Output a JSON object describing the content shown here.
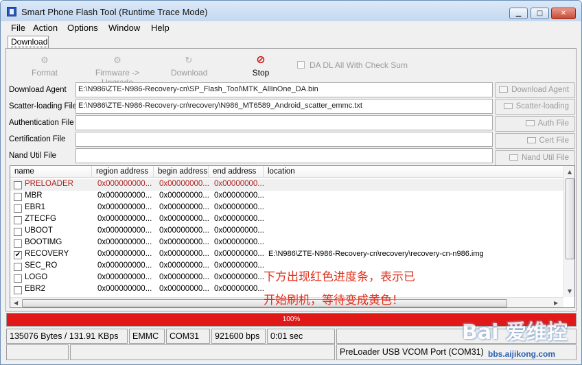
{
  "window": {
    "title": "Smart Phone Flash Tool (Runtime Trace Mode)"
  },
  "menu": [
    "File",
    "Action",
    "Options",
    "Window",
    "Help"
  ],
  "tab": "Download",
  "toolbar": {
    "format": "Format",
    "upgrade": "Firmware -> Upgrade",
    "download": "Download",
    "stop": "Stop",
    "checksum": "DA DL All With Check Sum"
  },
  "files": [
    {
      "label": "Download Agent",
      "value": "E:\\N986\\ZTE-N986-Recovery-cn\\SP_Flash_Tool\\MTK_AllInOne_DA.bin",
      "button": "Download Agent"
    },
    {
      "label": "Scatter-loading File",
      "value": "E:\\N986\\ZTE-N986-Recovery-cn\\recovery\\N986_MT6589_Android_scatter_emmc.txt",
      "button": "Scatter-loading"
    },
    {
      "label": "Authentication File",
      "value": "",
      "button": "Auth File"
    },
    {
      "label": "Certification File",
      "value": "",
      "button": "Cert File"
    },
    {
      "label": "Nand Util File",
      "value": "",
      "button": "Nand Util File"
    }
  ],
  "list": {
    "columns": [
      "name",
      "region address",
      "begin address",
      "end address",
      "location"
    ],
    "rows": [
      {
        "name": "PRELOADER",
        "region": "0x000000000...",
        "begin": "0x00000000...",
        "end": "0x00000000...",
        "location": "",
        "checked": false,
        "red": true
      },
      {
        "name": "MBR",
        "region": "0x000000000...",
        "begin": "0x00000000...",
        "end": "0x00000000...",
        "location": "",
        "checked": false,
        "red": false
      },
      {
        "name": "EBR1",
        "region": "0x000000000...",
        "begin": "0x00000000...",
        "end": "0x00000000...",
        "location": "",
        "checked": false,
        "red": false
      },
      {
        "name": "ZTECFG",
        "region": "0x000000000...",
        "begin": "0x00000000...",
        "end": "0x00000000...",
        "location": "",
        "checked": false,
        "red": false
      },
      {
        "name": "UBOOT",
        "region": "0x000000000...",
        "begin": "0x00000000...",
        "end": "0x00000000...",
        "location": "",
        "checked": false,
        "red": false
      },
      {
        "name": "BOOTIMG",
        "region": "0x000000000...",
        "begin": "0x00000000...",
        "end": "0x00000000...",
        "location": "",
        "checked": false,
        "red": false
      },
      {
        "name": "RECOVERY",
        "region": "0x000000000...",
        "begin": "0x00000000...",
        "end": "0x00000000...",
        "location": "E:\\N986\\ZTE-N986-Recovery-cn\\recovery\\recovery-cn-n986.img",
        "checked": true,
        "red": false
      },
      {
        "name": "SEC_RO",
        "region": "0x000000000...",
        "begin": "0x00000000...",
        "end": "0x00000000...",
        "location": "",
        "checked": false,
        "red": false
      },
      {
        "name": "LOGO",
        "region": "0x000000000...",
        "begin": "0x00000000...",
        "end": "0x00000000...",
        "location": "",
        "checked": false,
        "red": false
      },
      {
        "name": "EBR2",
        "region": "0x000000000...",
        "begin": "0x00000000...",
        "end": "0x00000000...",
        "location": "",
        "checked": false,
        "red": false
      }
    ]
  },
  "annotation": {
    "line1": "下方出现红色进度条，表示已",
    "line2": "开始刷机，等待变成黄色！",
    "color": "#e0301e"
  },
  "progress": {
    "value": 1.0,
    "text": "100%",
    "color": "#e01818"
  },
  "status": {
    "bytes": "135076 Bytes / 131.91 KBps",
    "storage": "EMMC",
    "port": "COM31",
    "baud": "921600 bps",
    "time": "0:01 sec",
    "device": "PreLoader USB VCOM Port (COM31)"
  },
  "watermark": {
    "logo": "Bai 爱维控",
    "url": "bbs.aijikong.com"
  }
}
